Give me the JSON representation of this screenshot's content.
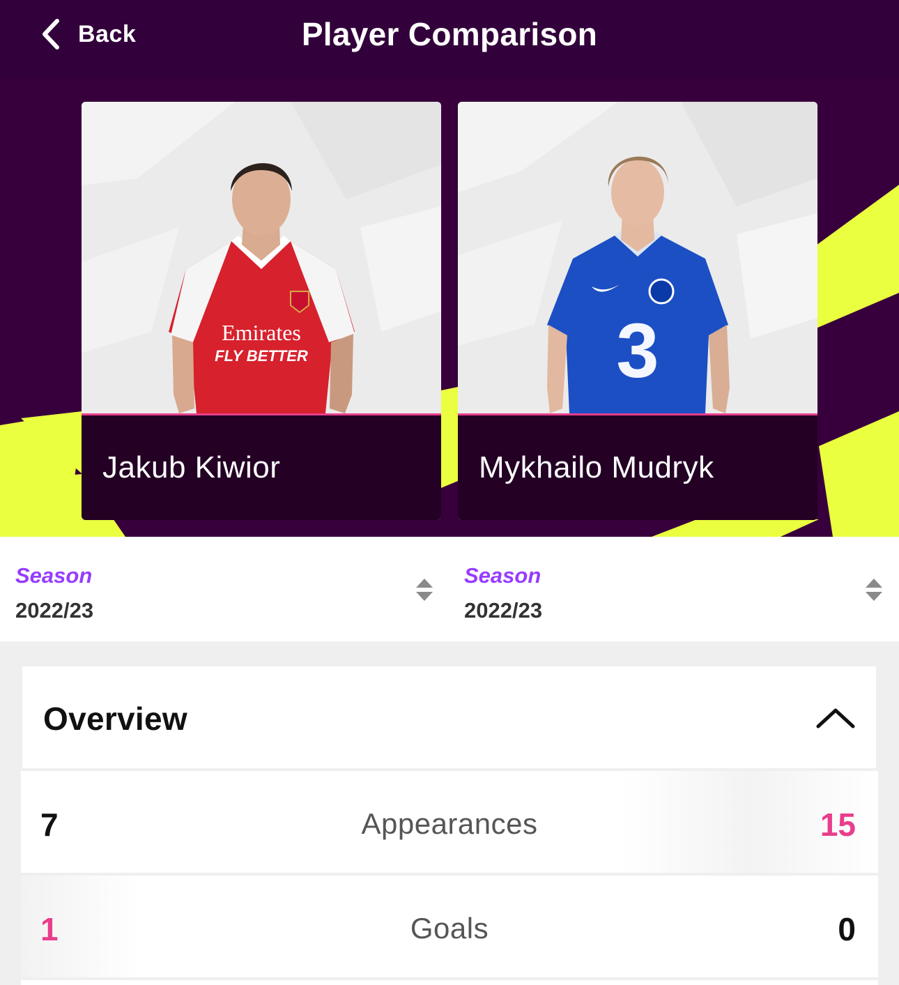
{
  "header": {
    "back_label": "Back",
    "title": "Player Comparison"
  },
  "players": [
    {
      "name": "Jakub Kiwior",
      "kit": "arsenal",
      "sponsor_line1": "Emirates",
      "sponsor_line2": "FLY BETTER"
    },
    {
      "name": "Mykhailo Mudryk",
      "kit": "chelsea",
      "sponsor_line1": "3"
    }
  ],
  "seasons": [
    {
      "label": "Season",
      "value": "2022/23"
    },
    {
      "label": "Season",
      "value": "2022/23"
    }
  ],
  "overview": {
    "title": "Overview",
    "expanded": true,
    "stats": [
      {
        "label": "Appearances",
        "left": "7",
        "right": "15",
        "leader": "right"
      },
      {
        "label": "Goals",
        "left": "1",
        "right": "0",
        "leader": "left"
      }
    ]
  },
  "colors": {
    "brand_purple": "#37003c",
    "namebar": "#230024",
    "accent_lime": "#e9ff40",
    "accent_pink": "#e83e8c",
    "season_purple": "#963cff"
  },
  "icons": {
    "back": "chevron-left-icon",
    "season_sort": "sort-arrows-icon",
    "collapse": "chevron-up-icon"
  }
}
